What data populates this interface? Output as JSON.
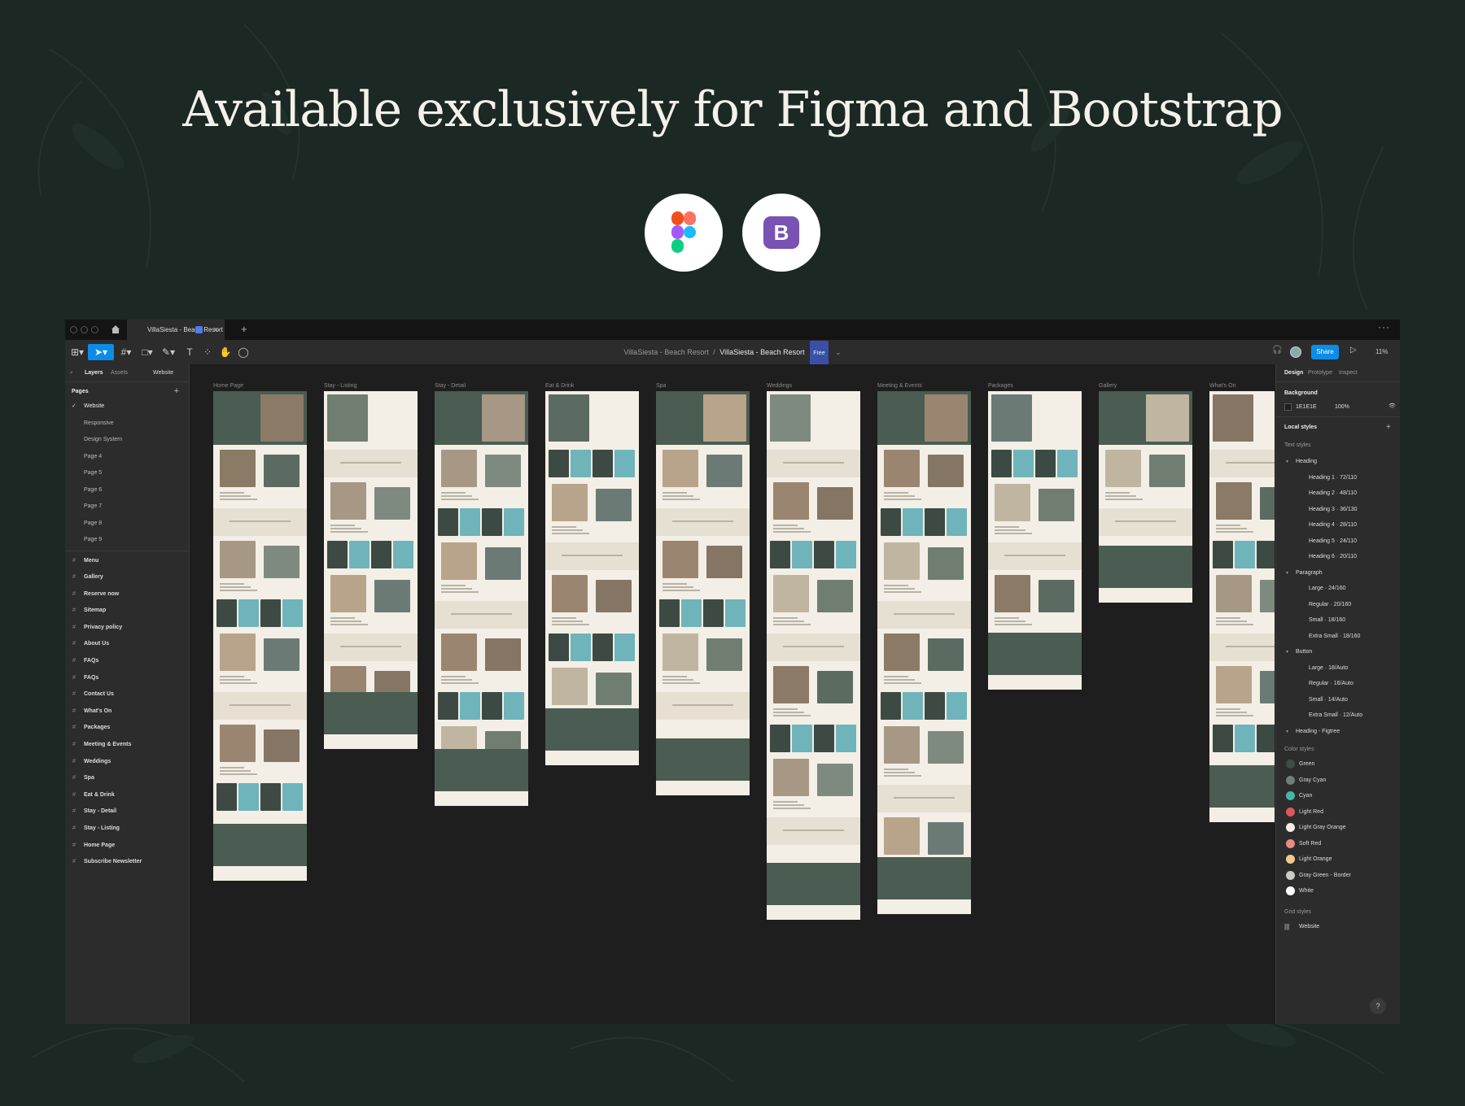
{
  "headline": "Available exclusively for Figma and Bootstrap",
  "logos": {
    "figma_icon": "figma-logo-icon",
    "bootstrap_letter": "B"
  },
  "colors": {
    "background": "#1b2823",
    "accent": "#0c8ce9",
    "bootstrap": "#7952b3"
  },
  "titlebar": {
    "tab_label": "VillaSiesta - Beach Resort",
    "tab_close": "×",
    "new_tab": "+",
    "more": "···"
  },
  "toolbar": {
    "path_project": "VillaSiesta - Beach Resort",
    "path_sep": "/",
    "path_file": "VillaSiesta - Beach Resort",
    "badge": "Free",
    "share_label": "Share",
    "zoom": "11%"
  },
  "left_panel": {
    "tabs": [
      "Layers",
      "Assets",
      "Website"
    ],
    "pages_title": "Pages",
    "pages": [
      "Website",
      "Responsive",
      "Design System",
      "Page 4",
      "Page 5",
      "Page 6",
      "Page 7",
      "Page 8",
      "Page 9"
    ],
    "frames": [
      "Menu",
      "Gallery",
      "Reserve now",
      "Sitemap",
      "Privacy policy",
      "About Us",
      "FAQs",
      "FAQs",
      "Contact Us",
      "What's On",
      "Packages",
      "Meeting & Events",
      "Weddings",
      "Spa",
      "Eat & Drink",
      "Stay - Detail",
      "Stay - Listing",
      "Home Page",
      "Subscribe Newsletter"
    ]
  },
  "canvas": {
    "frame_labels": [
      "Home Page",
      "Stay - Listing",
      "Stay - Detail",
      "Eat & Drink",
      "Spa",
      "Weddings",
      "Meeting & Events",
      "Packages",
      "Gallery",
      "What's On"
    ]
  },
  "right_panel": {
    "tabs": [
      "Design",
      "Prototype",
      "Inspect"
    ],
    "background_title": "Background",
    "background_hex": "1E1E1E",
    "background_opacity": "100%",
    "local_styles": "Local styles",
    "text_styles": "Text styles",
    "groups": {
      "heading": "Heading",
      "paragraph": "Paragraph",
      "button": "Button",
      "heading_figtree": "Heading - Figtree"
    },
    "ag": "Ag",
    "heading_styles": [
      "Heading 1 · 72/110",
      "Heading 2 · 48/110",
      "Heading 3 · 36/130",
      "Heading 4 · 28/110",
      "Heading 5 · 24/110",
      "Heading 6 · 20/110"
    ],
    "paragraph_styles": [
      "Large · 24/160",
      "Regular · 20/160",
      "Small · 18/160",
      "Extra Small · 18/160"
    ],
    "button_styles": [
      "Large · 18/Auto",
      "Regular · 16/Auto",
      "Small · 14/Auto",
      "Extra Small · 12/Auto"
    ],
    "color_styles_title": "Color styles",
    "color_styles": [
      {
        "name": "Green",
        "hex": "#3f4d45"
      },
      {
        "name": "Gray Cyan",
        "hex": "#6f7f7a"
      },
      {
        "name": "Cyan",
        "hex": "#45b7a7"
      },
      {
        "name": "Light Red",
        "hex": "#e0575a"
      },
      {
        "name": "Light Gray Orange",
        "hex": "#f3eee5"
      },
      {
        "name": "Soft Red",
        "hex": "#e88b84"
      },
      {
        "name": "Light Orange",
        "hex": "#f1c98e"
      },
      {
        "name": "Gray Green - Border",
        "hex": "#c9cdc6"
      },
      {
        "name": "White",
        "hex": "#ffffff"
      }
    ],
    "grid_styles_title": "Grid styles",
    "grid_style": "Website"
  },
  "help_label": "?"
}
